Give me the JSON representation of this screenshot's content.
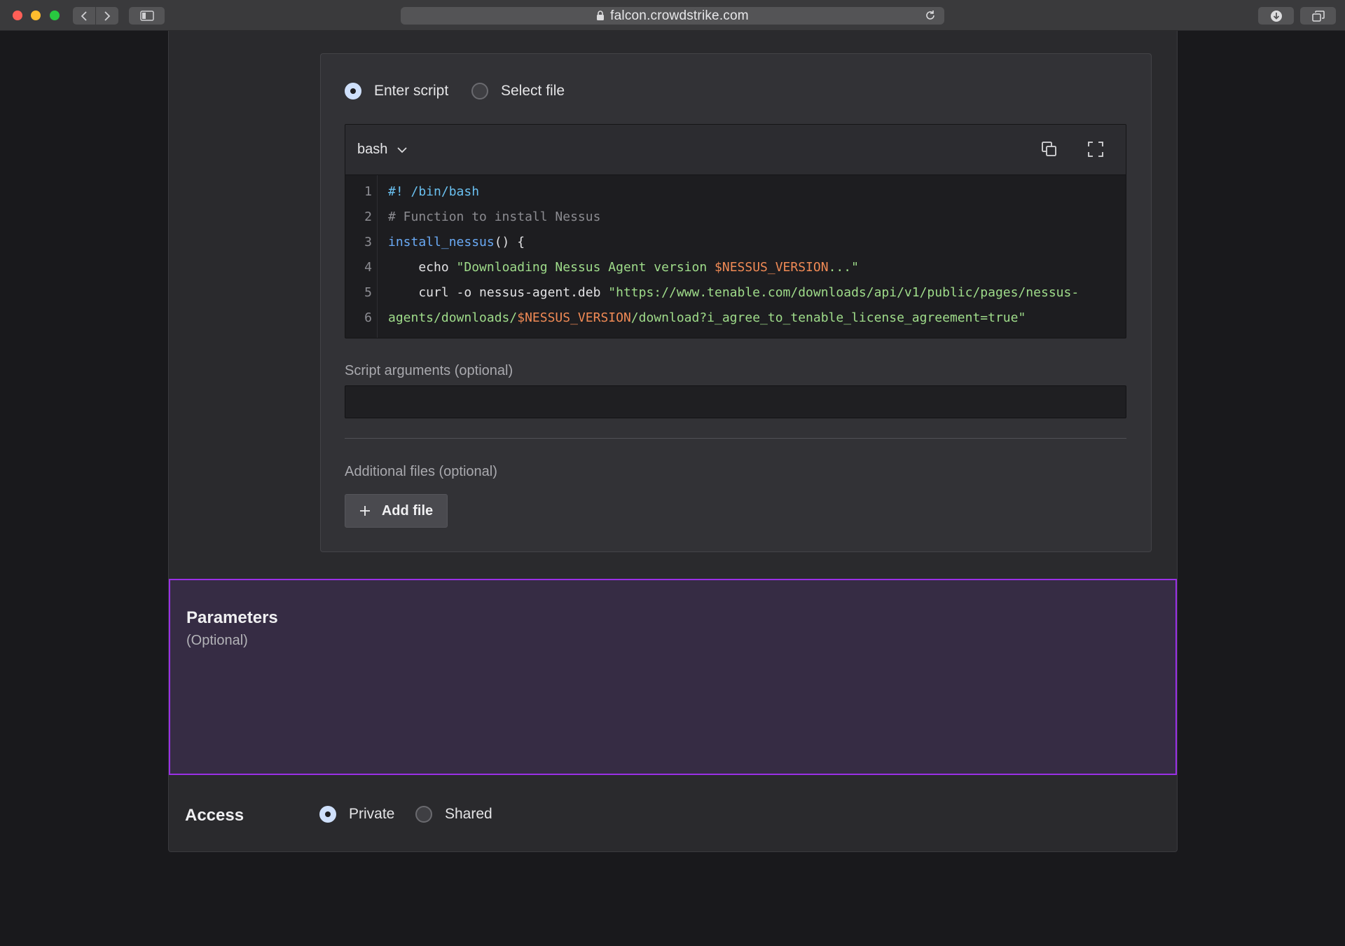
{
  "browser": {
    "url": "falcon.crowdstrike.com"
  },
  "script_source": {
    "options": [
      {
        "label": "Enter script",
        "selected": true
      },
      {
        "label": "Select file",
        "selected": false
      }
    ]
  },
  "editor": {
    "language": "bash",
    "lines": [
      {
        "number": "1",
        "parts": [
          {
            "text": "#! /bin/bash",
            "style": "shebang"
          }
        ]
      },
      {
        "number": "2",
        "parts": [
          {
            "text": "# Function to install Nessus",
            "style": "comment"
          }
        ]
      },
      {
        "number": "3",
        "parts": [
          {
            "text": "install_nessus",
            "style": "func"
          },
          {
            "text": "() {",
            "style": "plain"
          }
        ]
      },
      {
        "number": "4",
        "parts": [
          {
            "text": "    echo ",
            "style": "plain"
          },
          {
            "text": "\"Downloading Nessus Agent version ",
            "style": "str"
          },
          {
            "text": "$NESSUS_VERSION",
            "style": "var"
          },
          {
            "text": "...\"",
            "style": "str"
          }
        ]
      },
      {
        "number": "5",
        "parts": [
          {
            "text": "    curl -o nessus-agent.deb ",
            "style": "plain"
          },
          {
            "text": "\"https://www.tenable.com/downloads/api/v1/public/pages/nessus-",
            "style": "str"
          }
        ]
      },
      {
        "number": "6",
        "parts": [
          {
            "text": "agents/downloads/",
            "style": "str"
          },
          {
            "text": "$NESSUS_VERSION",
            "style": "var"
          },
          {
            "text": "/download?i_agree_to_tenable_license_agreement=true\"",
            "style": "str"
          }
        ]
      }
    ]
  },
  "script_arguments": {
    "label": "Script arguments (optional)",
    "value": "",
    "placeholder": ""
  },
  "additional_files": {
    "label": "Additional files (optional)",
    "add_button_label": "Add file"
  },
  "parameters": {
    "title": "Parameters",
    "subtitle": "(Optional)"
  },
  "access": {
    "title": "Access",
    "options": [
      {
        "label": "Private",
        "selected": true
      },
      {
        "label": "Shared",
        "selected": false
      }
    ]
  },
  "colors": {
    "accent_highlight": "#9a30e6",
    "radio_selected": "#cfe0fb"
  }
}
